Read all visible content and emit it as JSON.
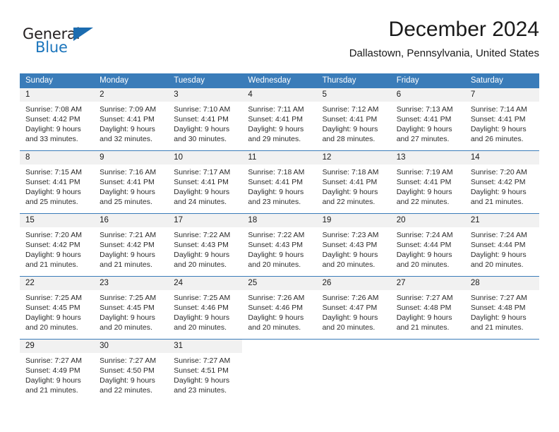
{
  "logo": {
    "word_top": "General",
    "word_bottom": "Blue",
    "accent_color": "#1b6cb0"
  },
  "header": {
    "title": "December 2024",
    "subtitle": "Dallastown, Pennsylvania, United States"
  },
  "calendar": {
    "header_color": "#3a7cb9",
    "band_color": "#f1f1f1",
    "weekdays": [
      "Sunday",
      "Monday",
      "Tuesday",
      "Wednesday",
      "Thursday",
      "Friday",
      "Saturday"
    ],
    "weeks": [
      [
        {
          "day": "1",
          "lines": [
            "Sunrise: 7:08 AM",
            "Sunset: 4:42 PM",
            "Daylight: 9 hours",
            "and 33 minutes."
          ]
        },
        {
          "day": "2",
          "lines": [
            "Sunrise: 7:09 AM",
            "Sunset: 4:41 PM",
            "Daylight: 9 hours",
            "and 32 minutes."
          ]
        },
        {
          "day": "3",
          "lines": [
            "Sunrise: 7:10 AM",
            "Sunset: 4:41 PM",
            "Daylight: 9 hours",
            "and 30 minutes."
          ]
        },
        {
          "day": "4",
          "lines": [
            "Sunrise: 7:11 AM",
            "Sunset: 4:41 PM",
            "Daylight: 9 hours",
            "and 29 minutes."
          ]
        },
        {
          "day": "5",
          "lines": [
            "Sunrise: 7:12 AM",
            "Sunset: 4:41 PM",
            "Daylight: 9 hours",
            "and 28 minutes."
          ]
        },
        {
          "day": "6",
          "lines": [
            "Sunrise: 7:13 AM",
            "Sunset: 4:41 PM",
            "Daylight: 9 hours",
            "and 27 minutes."
          ]
        },
        {
          "day": "7",
          "lines": [
            "Sunrise: 7:14 AM",
            "Sunset: 4:41 PM",
            "Daylight: 9 hours",
            "and 26 minutes."
          ]
        }
      ],
      [
        {
          "day": "8",
          "lines": [
            "Sunrise: 7:15 AM",
            "Sunset: 4:41 PM",
            "Daylight: 9 hours",
            "and 25 minutes."
          ]
        },
        {
          "day": "9",
          "lines": [
            "Sunrise: 7:16 AM",
            "Sunset: 4:41 PM",
            "Daylight: 9 hours",
            "and 25 minutes."
          ]
        },
        {
          "day": "10",
          "lines": [
            "Sunrise: 7:17 AM",
            "Sunset: 4:41 PM",
            "Daylight: 9 hours",
            "and 24 minutes."
          ]
        },
        {
          "day": "11",
          "lines": [
            "Sunrise: 7:18 AM",
            "Sunset: 4:41 PM",
            "Daylight: 9 hours",
            "and 23 minutes."
          ]
        },
        {
          "day": "12",
          "lines": [
            "Sunrise: 7:18 AM",
            "Sunset: 4:41 PM",
            "Daylight: 9 hours",
            "and 22 minutes."
          ]
        },
        {
          "day": "13",
          "lines": [
            "Sunrise: 7:19 AM",
            "Sunset: 4:41 PM",
            "Daylight: 9 hours",
            "and 22 minutes."
          ]
        },
        {
          "day": "14",
          "lines": [
            "Sunrise: 7:20 AM",
            "Sunset: 4:42 PM",
            "Daylight: 9 hours",
            "and 21 minutes."
          ]
        }
      ],
      [
        {
          "day": "15",
          "lines": [
            "Sunrise: 7:20 AM",
            "Sunset: 4:42 PM",
            "Daylight: 9 hours",
            "and 21 minutes."
          ]
        },
        {
          "day": "16",
          "lines": [
            "Sunrise: 7:21 AM",
            "Sunset: 4:42 PM",
            "Daylight: 9 hours",
            "and 21 minutes."
          ]
        },
        {
          "day": "17",
          "lines": [
            "Sunrise: 7:22 AM",
            "Sunset: 4:43 PM",
            "Daylight: 9 hours",
            "and 20 minutes."
          ]
        },
        {
          "day": "18",
          "lines": [
            "Sunrise: 7:22 AM",
            "Sunset: 4:43 PM",
            "Daylight: 9 hours",
            "and 20 minutes."
          ]
        },
        {
          "day": "19",
          "lines": [
            "Sunrise: 7:23 AM",
            "Sunset: 4:43 PM",
            "Daylight: 9 hours",
            "and 20 minutes."
          ]
        },
        {
          "day": "20",
          "lines": [
            "Sunrise: 7:24 AM",
            "Sunset: 4:44 PM",
            "Daylight: 9 hours",
            "and 20 minutes."
          ]
        },
        {
          "day": "21",
          "lines": [
            "Sunrise: 7:24 AM",
            "Sunset: 4:44 PM",
            "Daylight: 9 hours",
            "and 20 minutes."
          ]
        }
      ],
      [
        {
          "day": "22",
          "lines": [
            "Sunrise: 7:25 AM",
            "Sunset: 4:45 PM",
            "Daylight: 9 hours",
            "and 20 minutes."
          ]
        },
        {
          "day": "23",
          "lines": [
            "Sunrise: 7:25 AM",
            "Sunset: 4:45 PM",
            "Daylight: 9 hours",
            "and 20 minutes."
          ]
        },
        {
          "day": "24",
          "lines": [
            "Sunrise: 7:25 AM",
            "Sunset: 4:46 PM",
            "Daylight: 9 hours",
            "and 20 minutes."
          ]
        },
        {
          "day": "25",
          "lines": [
            "Sunrise: 7:26 AM",
            "Sunset: 4:46 PM",
            "Daylight: 9 hours",
            "and 20 minutes."
          ]
        },
        {
          "day": "26",
          "lines": [
            "Sunrise: 7:26 AM",
            "Sunset: 4:47 PM",
            "Daylight: 9 hours",
            "and 20 minutes."
          ]
        },
        {
          "day": "27",
          "lines": [
            "Sunrise: 7:27 AM",
            "Sunset: 4:48 PM",
            "Daylight: 9 hours",
            "and 21 minutes."
          ]
        },
        {
          "day": "28",
          "lines": [
            "Sunrise: 7:27 AM",
            "Sunset: 4:48 PM",
            "Daylight: 9 hours",
            "and 21 minutes."
          ]
        }
      ],
      [
        {
          "day": "29",
          "lines": [
            "Sunrise: 7:27 AM",
            "Sunset: 4:49 PM",
            "Daylight: 9 hours",
            "and 21 minutes."
          ]
        },
        {
          "day": "30",
          "lines": [
            "Sunrise: 7:27 AM",
            "Sunset: 4:50 PM",
            "Daylight: 9 hours",
            "and 22 minutes."
          ]
        },
        {
          "day": "31",
          "lines": [
            "Sunrise: 7:27 AM",
            "Sunset: 4:51 PM",
            "Daylight: 9 hours",
            "and 23 minutes."
          ]
        },
        {
          "day": "",
          "lines": []
        },
        {
          "day": "",
          "lines": []
        },
        {
          "day": "",
          "lines": []
        },
        {
          "day": "",
          "lines": []
        }
      ]
    ]
  }
}
